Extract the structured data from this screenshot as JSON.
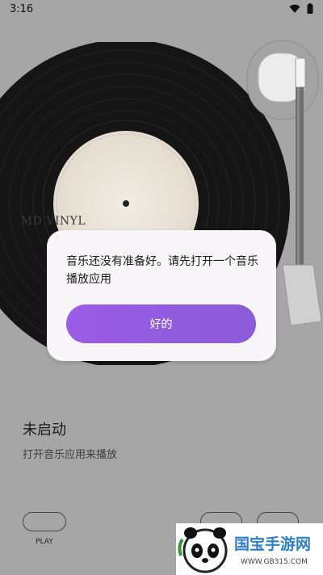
{
  "status_bar": {
    "time": "3:16",
    "icons": [
      "wifi-icon",
      "battery-icon"
    ]
  },
  "record": {
    "label_text": "MD VINYL"
  },
  "track": {
    "title": "未启动",
    "subtitle": "打开音乐应用来播放"
  },
  "controls": {
    "play_label": "PLAY"
  },
  "dialog": {
    "message": "音乐还没有准备好。请先打开一个音乐播放应用",
    "ok_label": "好的"
  },
  "watermark": {
    "text": "国宝手游网",
    "url": "WWW.GB315.COM"
  },
  "colors": {
    "background": "#a6a6a6",
    "dialog_bg": "#f7f5f8",
    "accent": "#9b5ce6"
  }
}
